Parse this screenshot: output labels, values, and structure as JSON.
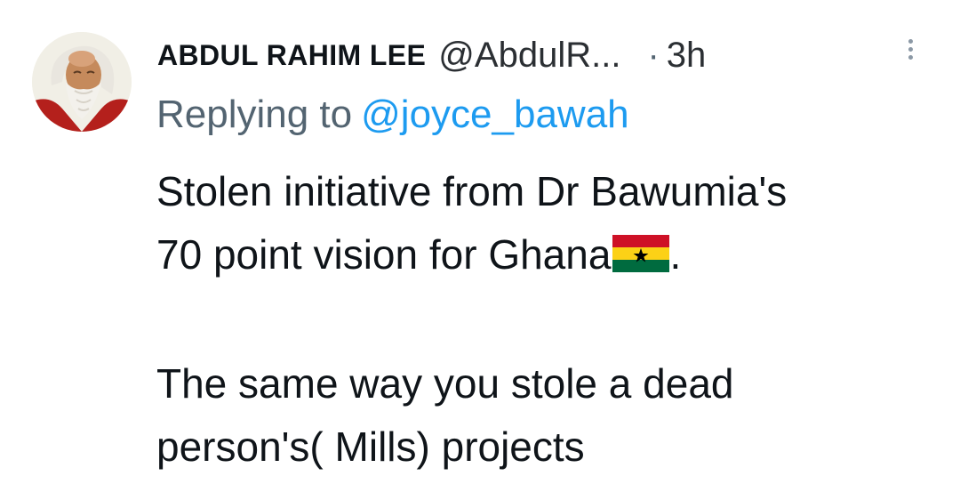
{
  "tweet": {
    "author_name": "ABDUL RAHIM LEE",
    "author_handle": "@AbdulR...",
    "separator": "·",
    "time": "3h",
    "replying_prefix": "Replying to",
    "replying_mention": "@joyce_bawah",
    "body": {
      "line1": "Stolen initiative from Dr Bawumia's",
      "line2_text": "70 point vision for Ghana",
      "line2_suffix": ".",
      "line3": "The same way you stole a dead",
      "line4": "person's( Mills) projects"
    },
    "flag_emoji": "ghana-flag-icon",
    "more_icon": "more-options-icon"
  },
  "colors": {
    "mention": "#1d9bf0",
    "secondary_text": "#536471",
    "primary_text": "#0f1419",
    "flag_red": "#ce1126",
    "flag_gold": "#fcd116",
    "flag_green": "#006b3f"
  }
}
